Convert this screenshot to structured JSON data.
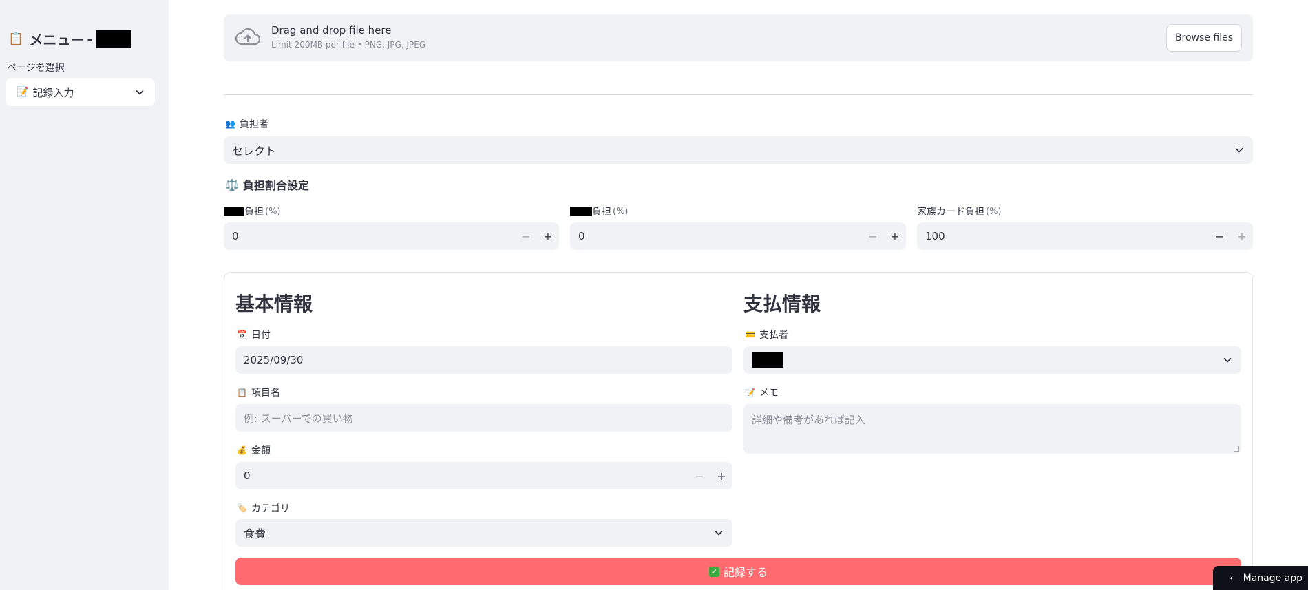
{
  "sidebar": {
    "title_emoji": "📋",
    "title": "メニュー",
    "title_sep": "-",
    "page_label": "ページを選択",
    "page_select": {
      "emoji": "📝",
      "value": "記録入力"
    }
  },
  "uploader": {
    "title": "Drag and drop file here",
    "subtitle": "Limit 200MB per file • PNG, JPG, JPEG",
    "button": "Browse files"
  },
  "burden": {
    "label_emoji": "👥",
    "label": "負担者",
    "value": "セレクト"
  },
  "ratio": {
    "heading_emoji": "⚖️",
    "heading": "負担割合設定",
    "fields": [
      {
        "label": "負担",
        "unit": "(%)",
        "value": "0"
      },
      {
        "label": "負担",
        "unit": "(%)",
        "value": "0"
      },
      {
        "label": "家族カード負担",
        "unit": "(%)",
        "value": "100"
      }
    ]
  },
  "basic": {
    "heading": "基本情報",
    "date": {
      "emoji": "📅",
      "label": "日付",
      "value": "2025/09/30"
    },
    "item": {
      "emoji": "📋",
      "label": "項目名",
      "placeholder": "例: スーパーでの買い物"
    },
    "amount": {
      "emoji": "💰",
      "label": "金額",
      "value": "0"
    },
    "category": {
      "emoji": "🏷️",
      "label": "カテゴリ",
      "value": "食費"
    }
  },
  "payment": {
    "heading": "支払情報",
    "payer": {
      "emoji": "💳",
      "label": "支払者"
    },
    "memo": {
      "emoji": "📝",
      "label": "メモ",
      "placeholder": "詳細や備考があれば記入"
    }
  },
  "submit": {
    "label": "記録する",
    "check": "✓"
  },
  "manage": {
    "label": "Manage app",
    "chevron": "‹"
  },
  "steppers": {
    "minus": "−",
    "plus": "+"
  },
  "colors": {
    "primary": "#ff6b6e",
    "sidebar_bg": "#f0f2f6",
    "input_bg": "#f0f2f6",
    "text": "#31333f"
  }
}
